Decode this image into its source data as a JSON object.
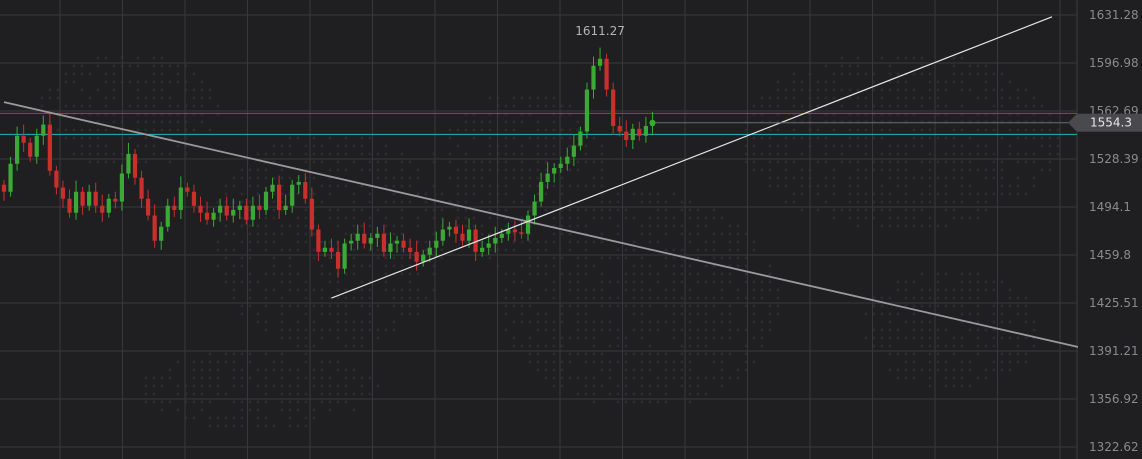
{
  "chart_data": {
    "type": "candlestick",
    "y_ticks": [
      "1631.28",
      "1596.98",
      "1562.69",
      "1528.39",
      "1494.1",
      "1459.8",
      "1425.51",
      "1391.21",
      "1356.92",
      "1322.62"
    ],
    "ylim": [
      1322.62,
      1631.28
    ],
    "grid": true,
    "annotations": {
      "peak_label": "1611.27",
      "peak_value": 1611.27,
      "last_price_label": "1554.3",
      "last_price": 1554.3
    },
    "horizontal_lines": [
      {
        "value": 1561.0,
        "color": "#c0392b"
      },
      {
        "value": 1546.0,
        "color": "#1fb5c4"
      }
    ],
    "trend_lines": [
      {
        "color": "#9a9a9e",
        "from": {
          "i": 0,
          "y": 1569
        },
        "to": {
          "i": 165,
          "y": 1393
        }
      },
      {
        "color": "#e6e6e6",
        "from": {
          "i": 50,
          "y": 1429
        },
        "to": {
          "i": 160,
          "y": 1630
        }
      }
    ],
    "colors": {
      "up": "#3aaa35",
      "down": "#c9302c",
      "grid": "#38383c",
      "axis_text": "#8a8a8e"
    },
    "candles": [
      [
        1510,
        1505
      ],
      [
        1505,
        1525
      ],
      [
        1525,
        1545
      ],
      [
        1545,
        1540
      ],
      [
        1540,
        1530
      ],
      [
        1530,
        1545
      ],
      [
        1545,
        1553
      ],
      [
        1553,
        1520
      ],
      [
        1520,
        1508
      ],
      [
        1508,
        1500
      ],
      [
        1500,
        1490
      ],
      [
        1490,
        1505
      ],
      [
        1505,
        1495
      ],
      [
        1495,
        1505
      ],
      [
        1505,
        1495
      ],
      [
        1495,
        1490
      ],
      [
        1490,
        1500
      ],
      [
        1500,
        1498
      ],
      [
        1498,
        1518
      ],
      [
        1518,
        1532
      ],
      [
        1532,
        1515
      ],
      [
        1515,
        1500
      ],
      [
        1500,
        1488
      ],
      [
        1488,
        1470
      ],
      [
        1470,
        1480
      ],
      [
        1480,
        1495
      ],
      [
        1495,
        1492
      ],
      [
        1492,
        1508
      ],
      [
        1508,
        1505
      ],
      [
        1505,
        1495
      ],
      [
        1495,
        1490
      ],
      [
        1490,
        1485
      ],
      [
        1485,
        1490
      ],
      [
        1490,
        1495
      ],
      [
        1495,
        1488
      ],
      [
        1488,
        1492
      ],
      [
        1492,
        1495
      ],
      [
        1495,
        1485
      ],
      [
        1485,
        1495
      ],
      [
        1495,
        1492
      ],
      [
        1492,
        1505
      ],
      [
        1505,
        1510
      ],
      [
        1510,
        1492
      ],
      [
        1492,
        1495
      ],
      [
        1495,
        1510
      ],
      [
        1510,
        1512
      ],
      [
        1512,
        1500
      ],
      [
        1500,
        1478
      ],
      [
        1478,
        1462
      ],
      [
        1462,
        1465
      ],
      [
        1465,
        1462
      ],
      [
        1462,
        1450
      ],
      [
        1450,
        1468
      ],
      [
        1468,
        1470
      ],
      [
        1470,
        1475
      ],
      [
        1475,
        1468
      ],
      [
        1468,
        1472
      ],
      [
        1472,
        1475
      ],
      [
        1475,
        1462
      ],
      [
        1462,
        1468
      ],
      [
        1468,
        1470
      ],
      [
        1470,
        1465
      ],
      [
        1465,
        1462
      ],
      [
        1462,
        1455
      ],
      [
        1455,
        1460
      ],
      [
        1460,
        1465
      ],
      [
        1465,
        1470
      ],
      [
        1470,
        1478
      ],
      [
        1478,
        1480
      ],
      [
        1480,
        1475
      ],
      [
        1475,
        1470
      ],
      [
        1470,
        1478
      ],
      [
        1478,
        1462
      ],
      [
        1462,
        1465
      ],
      [
        1465,
        1468
      ],
      [
        1468,
        1472
      ],
      [
        1472,
        1475
      ],
      [
        1475,
        1478
      ],
      [
        1478,
        1476
      ],
      [
        1476,
        1475
      ],
      [
        1475,
        1488
      ],
      [
        1488,
        1498
      ],
      [
        1498,
        1512
      ],
      [
        1512,
        1518
      ],
      [
        1518,
        1522
      ],
      [
        1522,
        1525
      ],
      [
        1525,
        1530
      ],
      [
        1530,
        1538
      ],
      [
        1538,
        1548
      ],
      [
        1548,
        1578
      ],
      [
        1578,
        1595
      ],
      [
        1595,
        1600
      ],
      [
        1600,
        1578
      ],
      [
        1578,
        1552
      ],
      [
        1552,
        1548
      ],
      [
        1548,
        1542
      ],
      [
        1542,
        1550
      ],
      [
        1550,
        1545
      ],
      [
        1545,
        1552
      ],
      [
        1552,
        1554
      ]
    ]
  }
}
